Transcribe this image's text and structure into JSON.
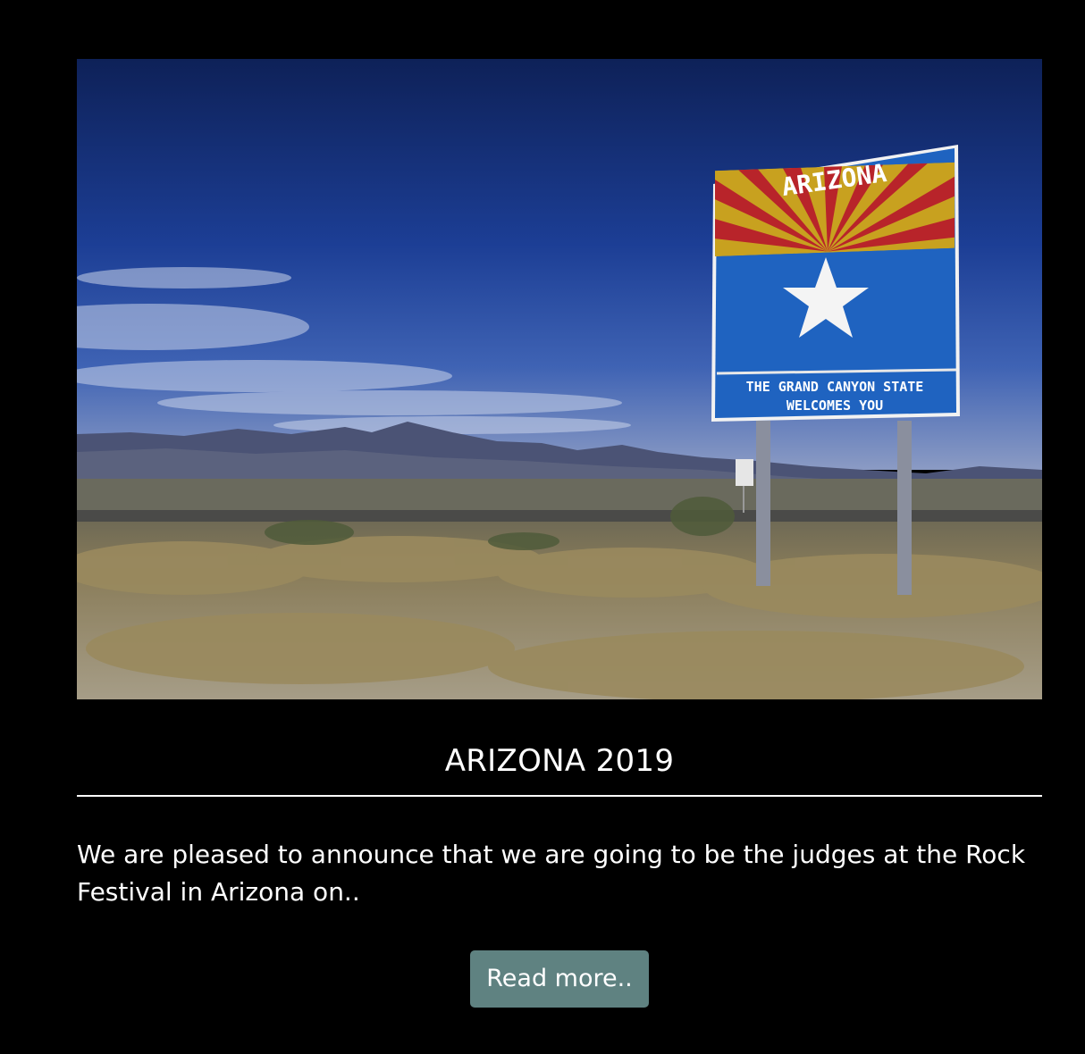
{
  "post": {
    "image_alt": "Arizona welcome sign on the highway",
    "sign": {
      "state_name": "ARIZONA",
      "line1": "THE GRAND CANYON STATE",
      "line2": "WELCOMES  YOU"
    },
    "title": "ARIZONA 2019",
    "excerpt": "We are pleased to announce that we are going to be the judges at the Rock Festival in Arizona on..",
    "read_more_label": "Read more.."
  },
  "colors": {
    "background": "#000000",
    "text": "#ffffff",
    "button": "#5f8281",
    "sky_top": "#0e2158",
    "sky_bottom": "#3f63b4"
  }
}
